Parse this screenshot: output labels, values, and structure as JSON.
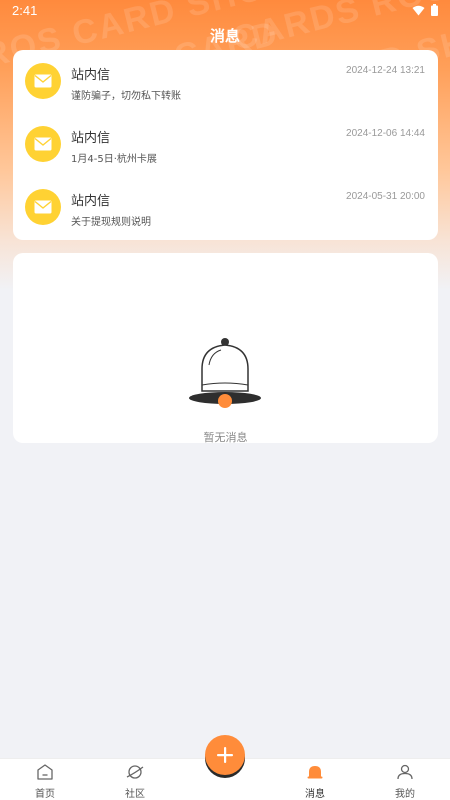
{
  "status_bar": {
    "time": "2:41"
  },
  "header": {
    "title": "消息"
  },
  "messages": [
    {
      "title": "站内信",
      "time": "2024-12-24 13:21",
      "preview": "谨防骗子，切勿私下转账",
      "icon": "envelope-icon"
    },
    {
      "title": "站内信",
      "time": "2024-12-06 14:44",
      "preview": "1月4-5日·杭州卡展",
      "icon": "envelope-icon"
    },
    {
      "title": "站内信",
      "time": "2024-05-31 20:00",
      "preview": "关于提现规则说明",
      "icon": "envelope-icon"
    }
  ],
  "empty_state": {
    "text": "暂无消息",
    "icon": "bell-icon"
  },
  "tabbar": {
    "items": [
      {
        "label": "首页",
        "icon": "home-icon",
        "active": false
      },
      {
        "label": "社区",
        "icon": "planet-icon",
        "active": false
      },
      {
        "label": "消息",
        "icon": "bell-icon",
        "active": true
      },
      {
        "label": "我的",
        "icon": "user-icon",
        "active": false
      }
    ],
    "fab_icon": "plus-icon"
  },
  "colors": {
    "accent": "#ff8c3a",
    "avatar": "#ffd233",
    "background": "#f1f2f6"
  }
}
